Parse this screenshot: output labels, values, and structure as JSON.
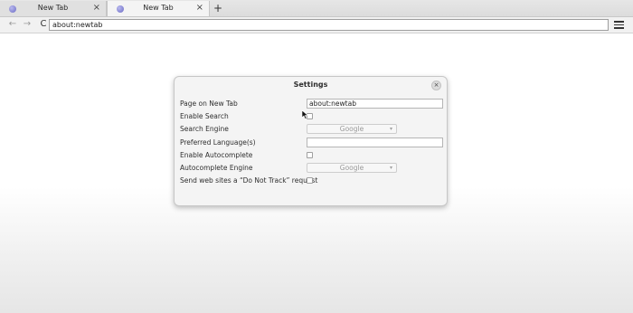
{
  "tabs": [
    {
      "label": "New Tab",
      "close": "×"
    },
    {
      "label": "New Tab",
      "close": "×"
    }
  ],
  "new_tab_symbol": "+",
  "nav": {
    "back": "←",
    "forward": "→",
    "reload": "C",
    "url": "about:newtab"
  },
  "dialog": {
    "title": "Settings",
    "close": "×",
    "rows": [
      {
        "label": "Page on New Tab",
        "value": "about:newtab"
      },
      {
        "label": "Enable Search"
      },
      {
        "label": "Search Engine",
        "value": "Google"
      },
      {
        "label": "Preferred Language(s)",
        "value": ""
      },
      {
        "label": "Enable Autocomplete"
      },
      {
        "label": "Autocomplete Engine",
        "value": "Google"
      },
      {
        "label": "Send web sites a “Do Not Track” request"
      }
    ]
  },
  "colors": {
    "favicon": "#6b6bc4",
    "window_bg": "#f4f4f4"
  }
}
